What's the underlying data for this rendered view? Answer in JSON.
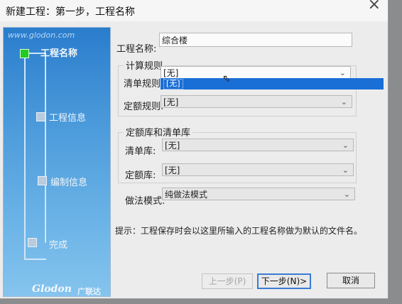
{
  "window": {
    "title": "新建工程：第一步，工程名称",
    "close_icon": "close-icon"
  },
  "sidebar": {
    "watermark": "www.glodon.com",
    "steps": [
      {
        "label": "工程名称",
        "active": true
      },
      {
        "label": "工程信息",
        "active": false
      },
      {
        "label": "编制信息",
        "active": false
      },
      {
        "label": "完成",
        "active": false
      }
    ],
    "logo": "Glodon",
    "logo_cn": "广联达"
  },
  "form": {
    "project_name": {
      "label": "工程名称:",
      "value": "综合楼"
    },
    "calc_rules": {
      "group_label": "计算规则",
      "bill_rule": {
        "label": "清单规则:",
        "value": "[无]",
        "open": true,
        "options": [
          "[无]"
        ]
      },
      "quota_rule": {
        "label": "定额规则:",
        "value": "[无]"
      }
    },
    "libraries": {
      "group_label": "定额库和清单库",
      "bill_lib": {
        "label": "清单库:",
        "value": "[无]"
      },
      "quota_lib": {
        "label": "定额库:",
        "value": "[无]"
      }
    },
    "mode": {
      "label": "做法模式:",
      "value": "纯做法模式"
    },
    "hint": "提示：工程保存时会以这里所输入的工程名称做为默认的文件名。"
  },
  "buttons": {
    "prev": "上一步(P)",
    "next": "下一步(N)>",
    "cancel": "取消"
  }
}
